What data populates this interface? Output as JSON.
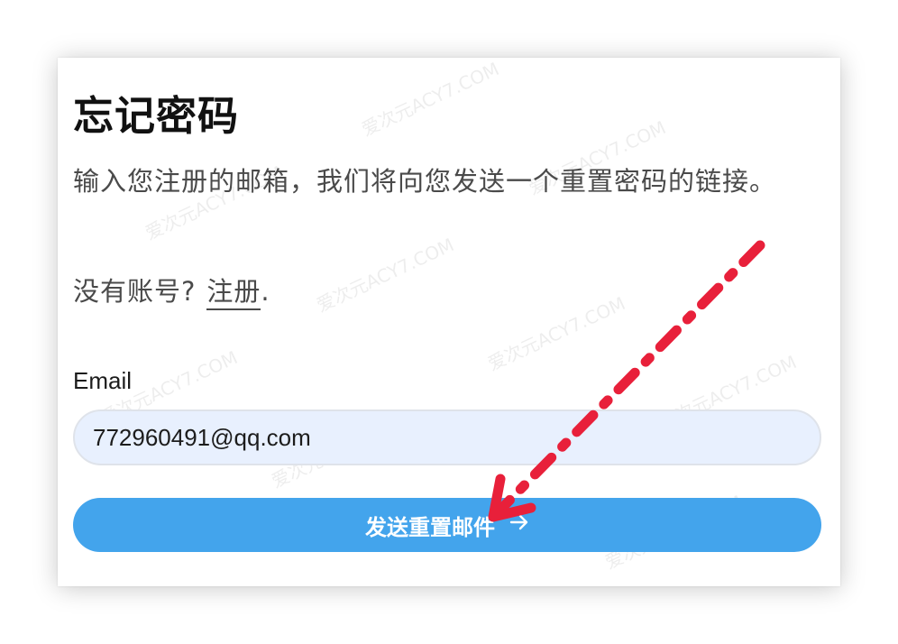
{
  "page": {
    "title": "忘记密码",
    "description": "输入您注册的邮箱，我们将向您发送一个重置密码的链接。"
  },
  "signup_prompt": {
    "text": "没有账号?",
    "link_label": "注册",
    "suffix": "."
  },
  "form": {
    "email_label": "Email",
    "email_value": "772960491@qq.com"
  },
  "submit": {
    "label": "发送重置邮件",
    "icon": "arrow-right-icon",
    "color": "#43a4ec"
  },
  "watermark_text": "爱次元ACY7.COM",
  "annotation": {
    "icon": "red-dashed-arrow",
    "color": "#e8203a"
  }
}
